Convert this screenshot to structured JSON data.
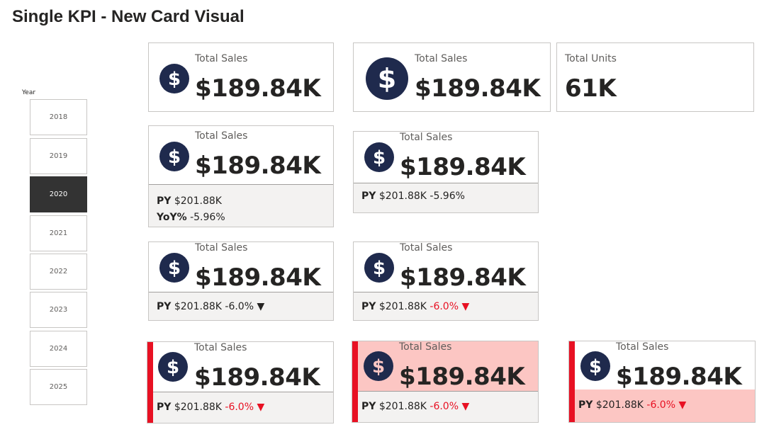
{
  "page": {
    "title": "Single KPI - New Card Visual"
  },
  "slicer": {
    "label": "Year",
    "years": [
      "2018",
      "2019",
      "2020",
      "2021",
      "2022",
      "2023",
      "2024",
      "2025"
    ],
    "selected": "2020"
  },
  "colors": {
    "icon_bg": "#1f2a4d",
    "negative": "#e81123",
    "accent": "#e81123",
    "highlight_bg": "#fcc6c3",
    "reference_bg": "#f3f2f1"
  },
  "icon": "dollar-icon",
  "cards": {
    "c1": {
      "label": "Total Sales",
      "value": "$189.84K"
    },
    "c2": {
      "label": "Total Sales",
      "value": "$189.84K"
    },
    "c3": {
      "label": "Total Units",
      "value": "61K"
    },
    "c4": {
      "label": "Total Sales",
      "value": "$189.84K",
      "py_label": "PY",
      "py_value": "$201.88K",
      "yoy_label": "YoY%",
      "yoy_value": "-5.96%"
    },
    "c5": {
      "label": "Total Sales",
      "value": "$189.84K",
      "py_label": "PY",
      "py_value": "$201.88K",
      "change": "-5.96%"
    },
    "c6": {
      "label": "Total Sales",
      "value": "$189.84K",
      "py_label": "PY",
      "py_value": "$201.88K",
      "change": "-6.0%",
      "arrow": "▼"
    },
    "c7": {
      "label": "Total Sales",
      "value": "$189.84K",
      "py_label": "PY",
      "py_value": "$201.88K",
      "change": "-6.0%",
      "arrow": "▼"
    },
    "c8": {
      "label": "Total Sales",
      "value": "$189.84K",
      "py_label": "PY",
      "py_value": "$201.88K",
      "change": "-6.0%",
      "arrow": "▼"
    },
    "c9": {
      "label": "Total Sales",
      "value": "$189.84K",
      "py_label": "PY",
      "py_value": "$201.88K",
      "change": "-6.0%",
      "arrow": "▼"
    },
    "c10": {
      "label": "Total Sales",
      "value": "$189.84K",
      "py_label": "PY",
      "py_value": "$201.88K",
      "change": "-6.0%",
      "arrow": "▼"
    }
  }
}
